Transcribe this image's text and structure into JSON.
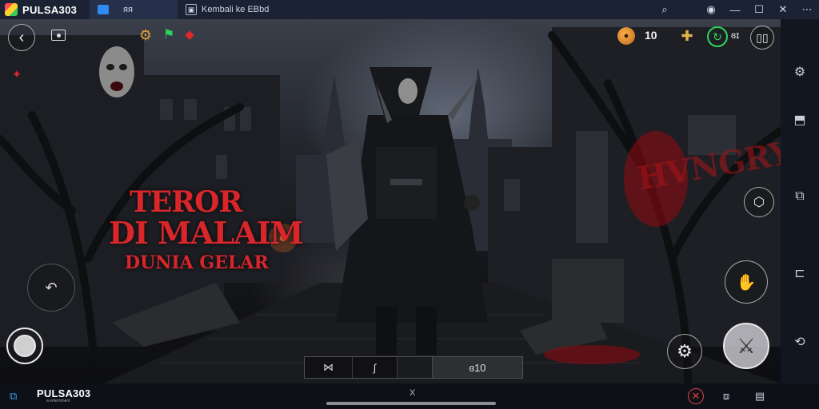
{
  "titlebar": {
    "app_name": "PULSA303",
    "home_tab_icon": "home-icon",
    "tab2_label": "ᴙᴙ",
    "game_tab_label": "Kembali ke EBbd",
    "right_icons": [
      "search-icon",
      "record-icon",
      "minimize-icon",
      "maximize-icon",
      "close-icon"
    ]
  },
  "game": {
    "title_line1": "TEROR",
    "title_line2": "DI MALAIM",
    "title_line3": "DUNIA GELAR",
    "wall_graffiti": "HVNGRY",
    "hud": {
      "coin_count": "10",
      "level_label": "ɞɪ"
    },
    "item_slots": [
      "⋈",
      "ʃ",
      "",
      "ɞ10"
    ]
  },
  "sidebar": {
    "icons": [
      "settings-icon",
      "fullscreen-icon",
      "screenshot-icon",
      "shake-icon",
      "back-icon",
      "rotate-icon"
    ]
  },
  "bottombar": {
    "brand": "PULSA303",
    "brand_sub": "a enternment",
    "close_mark": "X"
  },
  "colors": {
    "title_red": "#d8262b",
    "titlebar_bg": "#1b2233",
    "accent_green": "#2ed35b",
    "accent_blue": "#2e8cf0"
  }
}
